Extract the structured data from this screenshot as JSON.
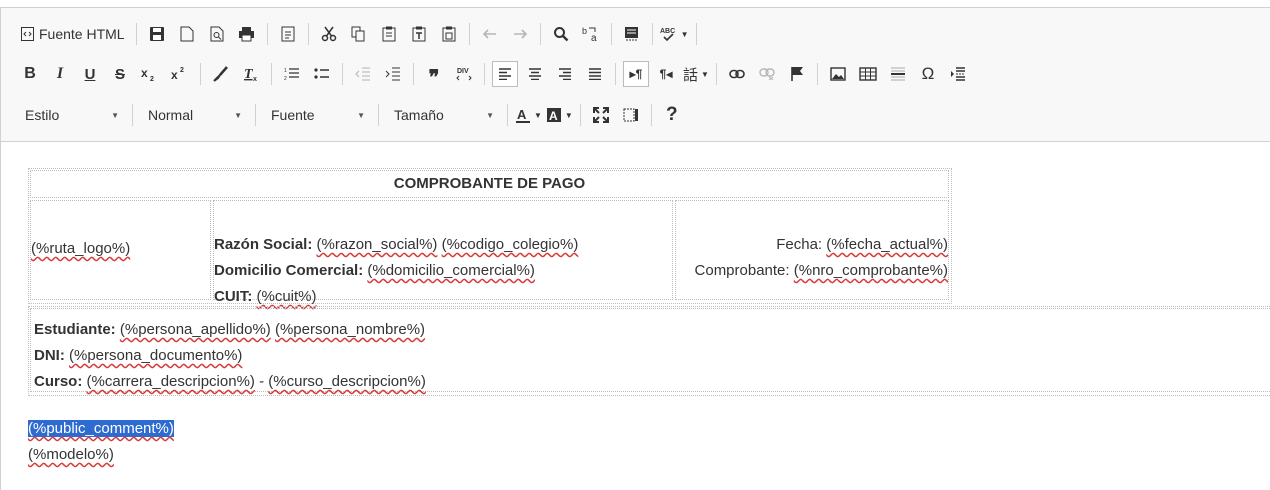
{
  "toolbar": {
    "source_label": "Fuente HTML",
    "style_dd": "Estilo",
    "format_dd": "Normal",
    "font_dd": "Fuente",
    "size_dd": "Tamaño",
    "help_label": "?",
    "omega_label": "Ω"
  },
  "doc": {
    "header_title": "COMPROBANTE DE PAGO",
    "logo": "(%ruta_logo%)",
    "razon_label": "Razón Social:",
    "razon_value": "(%razon_social%)",
    "codigo_value": "(%codigo_colegio%)",
    "domicilio_label": "Domicilio Comercial:",
    "domicilio_value": "(%domicilio_comercial%)",
    "cuit_label": "CUIT:",
    "cuit_value": "(%cuit%)",
    "fecha_label": "Fecha:",
    "fecha_value": "(%fecha_actual%)",
    "comprobante_label": "Comprobante:",
    "comprobante_value": "(%nro_comprobante%)",
    "estudiante_label": "Estudiante:",
    "apellido_value": "(%persona_apellido%)",
    "nombre_value": "(%persona_nombre%)",
    "dni_label": "DNI:",
    "dni_value": "(%persona_documento%)",
    "curso_label": "Curso:",
    "carrera_value": "(%carrera_descripcion%)",
    "dash": " - ",
    "curso_value": "(%curso_descripcion%)",
    "public_comment": "(%public_comment%)",
    "modelo": "(%modelo%)"
  }
}
